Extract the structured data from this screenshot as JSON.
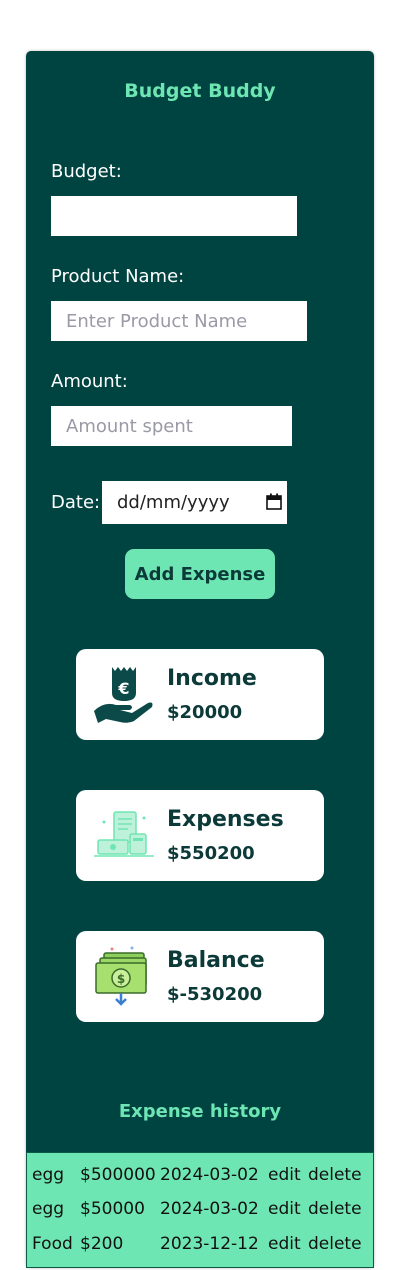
{
  "app": {
    "title": "Budget Buddy"
  },
  "form": {
    "budget_label": "Budget:",
    "budget_value": "",
    "product_label": "Product Name:",
    "product_placeholder": "Enter Product Name",
    "amount_label": "Amount:",
    "amount_placeholder": "Amount spent",
    "date_label": "Date:",
    "date_placeholder": "dd/mm/yyyy",
    "add_button": "Add Expense"
  },
  "summary": {
    "income": {
      "label": "Income",
      "value": "$20000",
      "icon": "hand-euro-icon"
    },
    "expenses": {
      "label": "Expenses",
      "value": "$550200",
      "icon": "receipt-cash-icon"
    },
    "balance": {
      "label": "Balance",
      "value": "$-530200",
      "icon": "money-stack-icon"
    }
  },
  "history": {
    "title": "Expense history",
    "rows": [
      {
        "name": "egg",
        "amount": "$500000",
        "date": "2024-03-02",
        "edit": "edit",
        "delete": "delete"
      },
      {
        "name": "egg",
        "amount": "$50000",
        "date": "2024-03-02",
        "edit": "edit",
        "delete": "delete"
      },
      {
        "name": "Food",
        "amount": "$200",
        "date": "2023-12-12",
        "edit": "edit",
        "delete": "delete"
      }
    ]
  },
  "colors": {
    "panel": "#004442",
    "accent": "#6ee6b3",
    "dark_text": "#0b3a38"
  }
}
